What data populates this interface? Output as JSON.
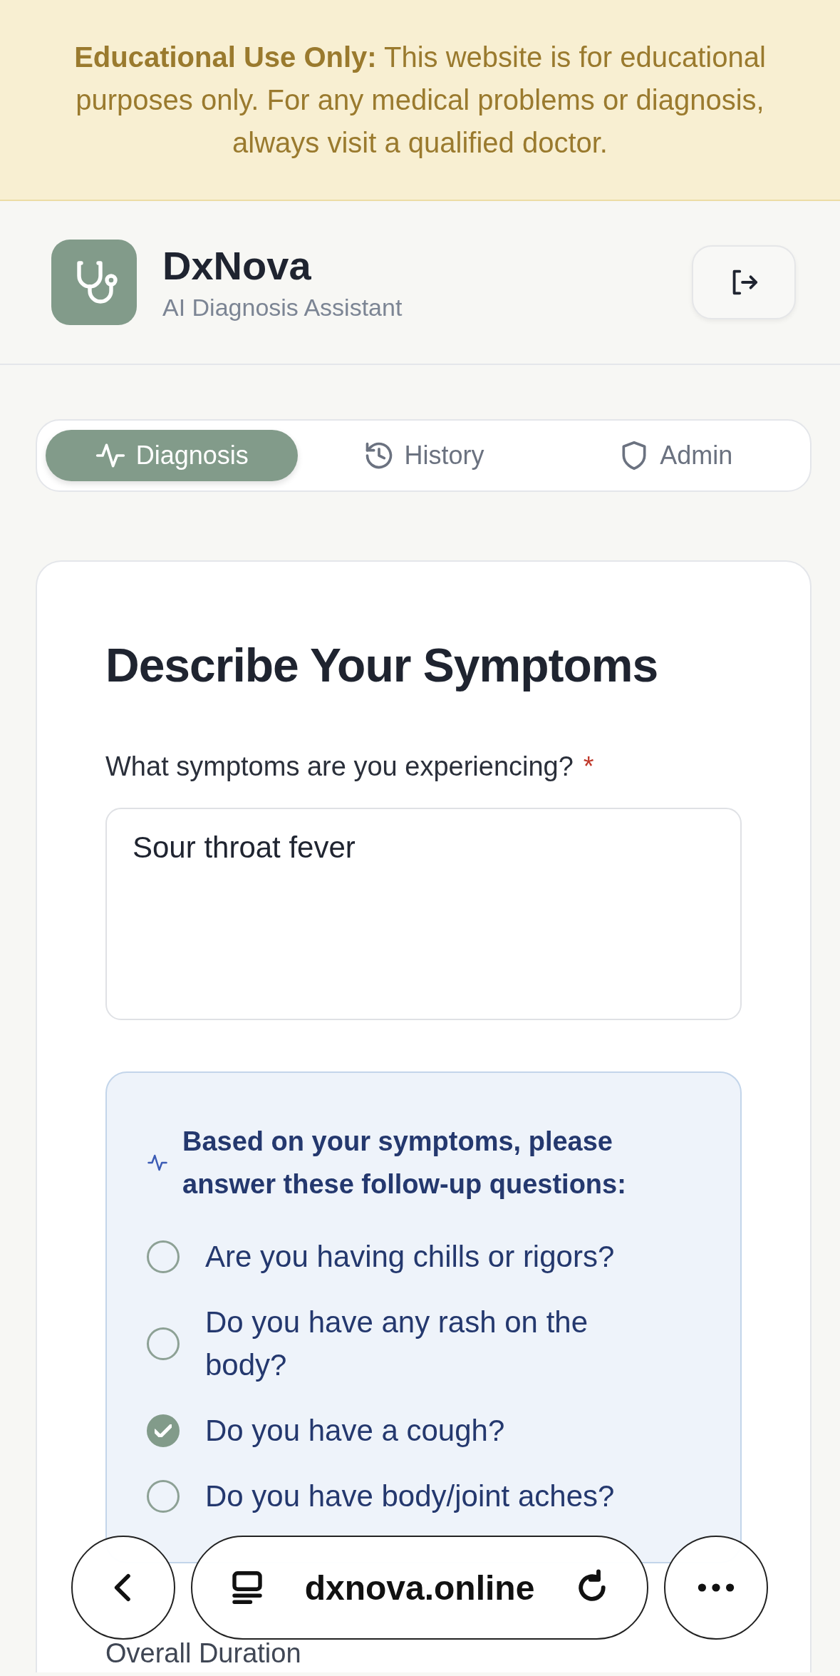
{
  "notice": {
    "text": "**Educational Use Only:** This website is for educational purposes only. For any medical problems or diagnosis, always visit a qualified doctor."
  },
  "header": {
    "title": "DxNova",
    "subtitle": "AI Diagnosis Assistant"
  },
  "tabs": [
    {
      "label": "Diagnosis",
      "selected": true
    },
    {
      "label": "History",
      "selected": false
    },
    {
      "label": "Admin",
      "selected": false
    }
  ],
  "form": {
    "title": "Describe Your Symptoms",
    "symptoms_label": "What symptoms are you experiencing?",
    "required_mark": "*",
    "symptoms_value": "Sour throat fever",
    "followup": {
      "heading": "Based on your symptoms, please answer these follow-up questions:",
      "questions": [
        {
          "text": "Are you having chills or rigors?",
          "checked": false
        },
        {
          "text": "Do you have any rash on the body?",
          "checked": false
        },
        {
          "text": "Do you have a cough?",
          "checked": true
        },
        {
          "text": "Do you have body/joint aches?",
          "checked": false
        }
      ]
    },
    "next_label": "Overall Duration"
  },
  "browser_bar": {
    "url": "dxnova.online"
  }
}
